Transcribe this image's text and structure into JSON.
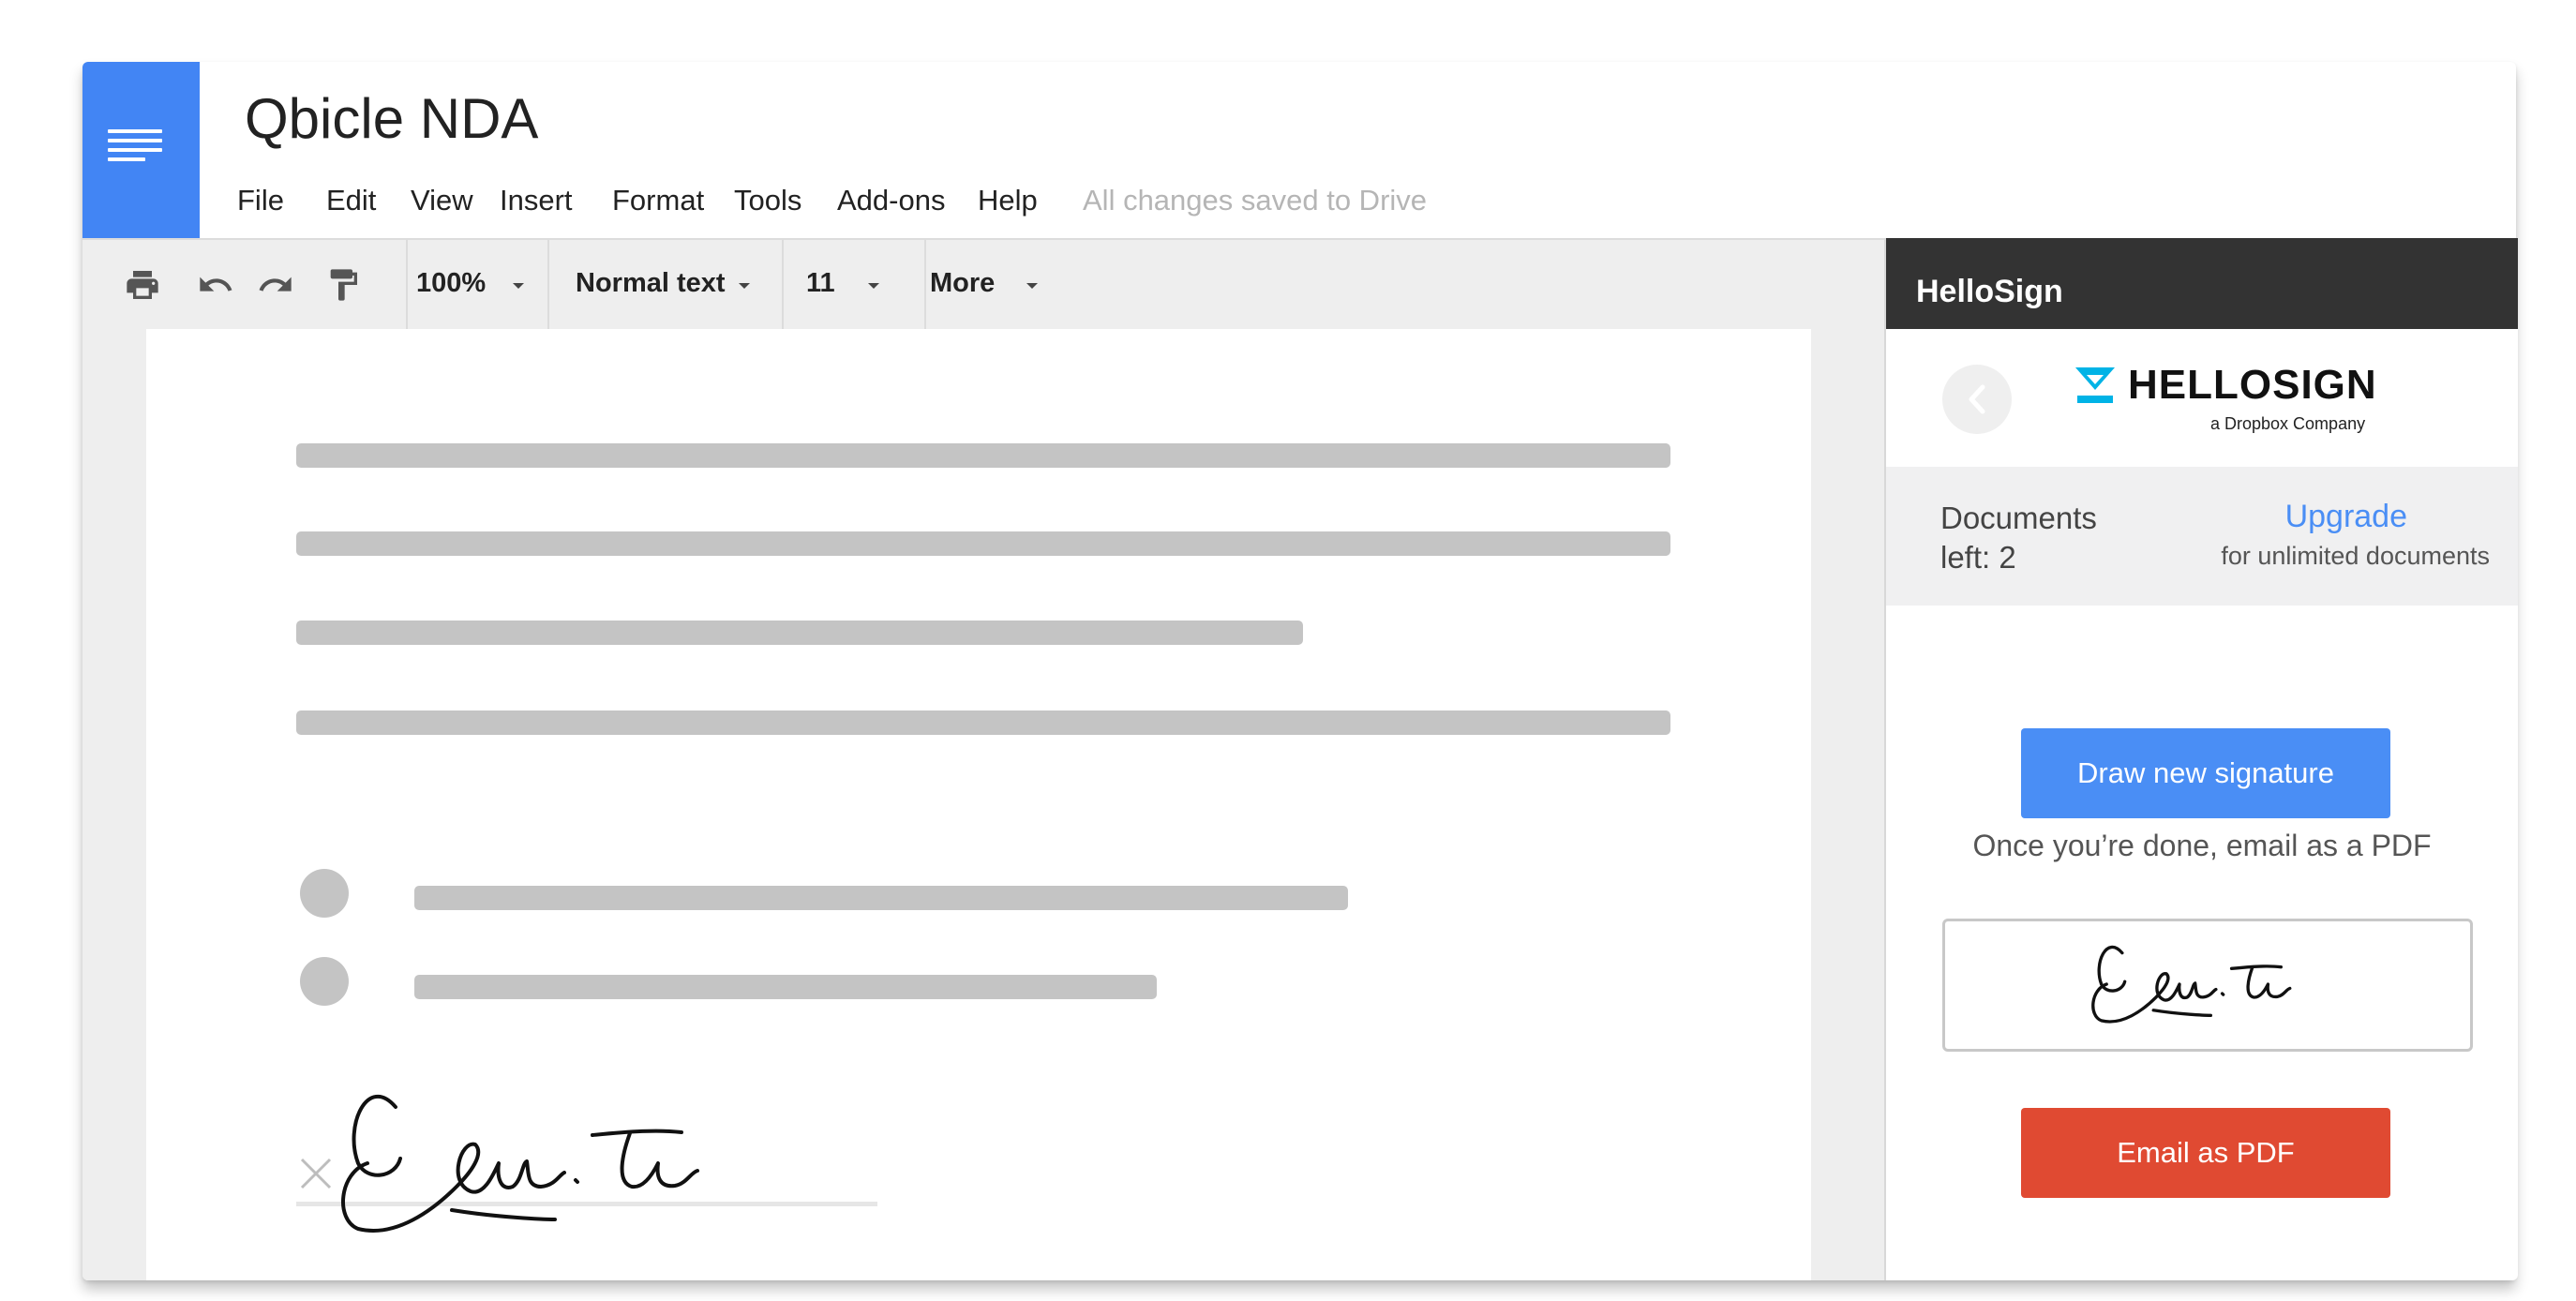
{
  "document": {
    "title": "Qbicle NDA",
    "menu": [
      "File",
      "Edit",
      "View",
      "Insert",
      "Format",
      "Tools",
      "Add-ons",
      "Help"
    ],
    "save_status": "All changes saved to Drive"
  },
  "toolbar": {
    "zoom": "100%",
    "style": "Normal text",
    "font_size": "11",
    "more": "More",
    "icons": [
      "print-icon",
      "undo-icon",
      "redo-icon",
      "paint-format-icon",
      "dropdown-caret-icon"
    ]
  },
  "panel": {
    "header_title": "HelloSign",
    "logo_text": "HELLOSIGN",
    "logo_subtext": "a Dropbox Company",
    "documents_left_label": "Documents",
    "documents_left_count": "left:  2",
    "upgrade_label": "Upgrade",
    "upgrade_subtext": "for unlimited documents",
    "draw_button": "Draw new signature",
    "instruction": "Once you’re done, email as a PDF",
    "email_button": "Email as PDF"
  },
  "colors": {
    "docs_blue": "#4285f4",
    "panel_header": "#333333",
    "primary_button": "#4a8ef5",
    "danger_button": "#e04a32",
    "hellosign_teal": "#00b3e6",
    "placeholder_bar": "#c4c4c4"
  }
}
